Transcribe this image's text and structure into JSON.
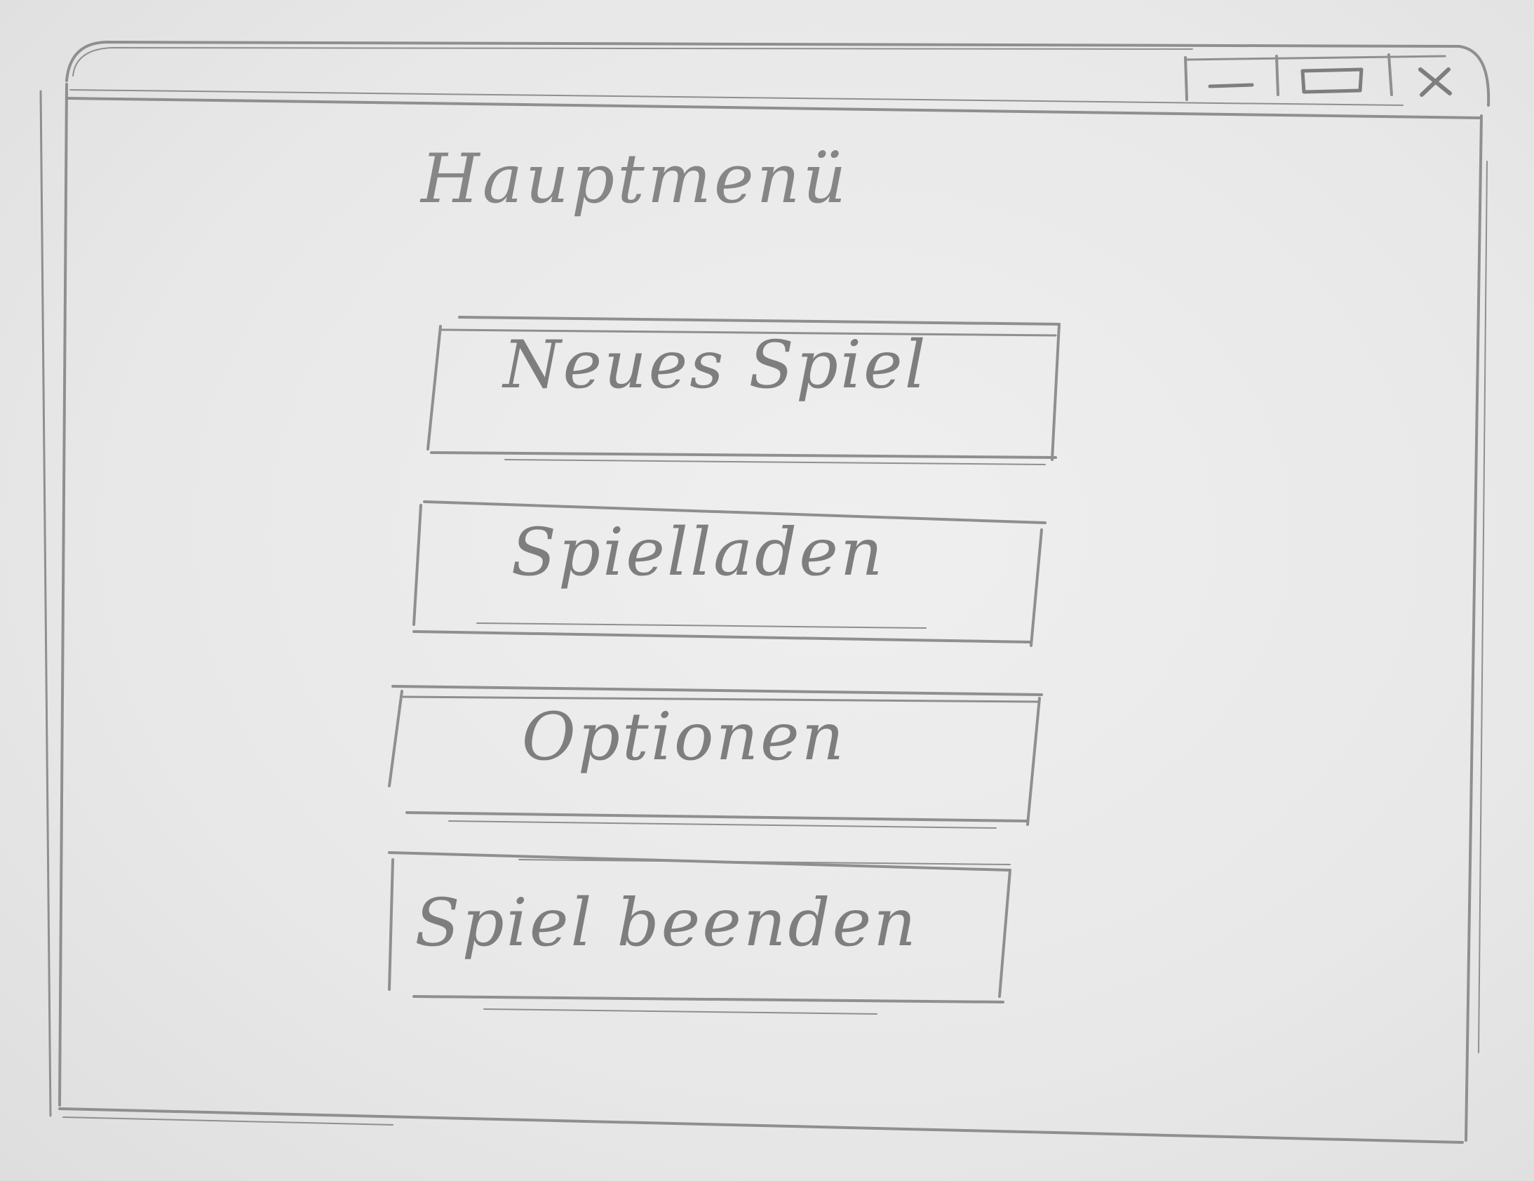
{
  "window": {
    "controls": {
      "minimize_icon": "minimize-icon",
      "maximize_icon": "maximize-icon",
      "close_icon": "close-icon"
    }
  },
  "main_menu": {
    "title": "Hauptmenü",
    "buttons": [
      {
        "label": "Neues Spiel"
      },
      {
        "label": "Spielladen"
      },
      {
        "label": "Optionen"
      },
      {
        "label": "Spiel beenden"
      }
    ]
  }
}
